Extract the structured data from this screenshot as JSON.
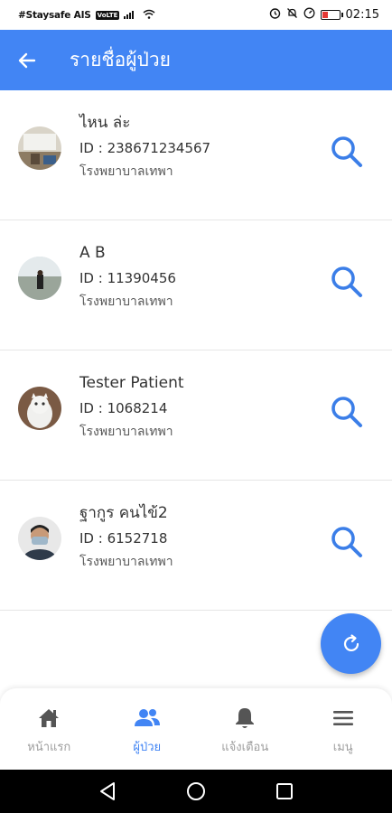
{
  "status_bar": {
    "carrier": "#Staysafe AIS",
    "volte": "VoLTE",
    "time": "02:15"
  },
  "app_bar": {
    "title": "รายชื่อผู้ป่วย"
  },
  "patients": [
    {
      "name": "ไหน ล่ะ",
      "id": "ID : 238671234567",
      "hospital": "โรงพยาบาลเทพา"
    },
    {
      "name": "A B",
      "id": "ID : 11390456",
      "hospital": "โรงพยาบาลเทพา"
    },
    {
      "name": "Tester Patient",
      "id": "ID : 1068214",
      "hospital": "โรงพยาบาลเทพา"
    },
    {
      "name": "ฐากูร คนไข้2",
      "id": "ID : 6152718",
      "hospital": "โรงพยาบาลเทพา"
    }
  ],
  "bottom_nav": {
    "items": [
      {
        "label": "หน้าแรก",
        "icon": "home-icon"
      },
      {
        "label": "ผู้ป่วย",
        "icon": "users-icon"
      },
      {
        "label": "แจ้งเตือน",
        "icon": "bell-icon"
      },
      {
        "label": "เมนู",
        "icon": "menu-icon"
      }
    ],
    "active_index": 1
  },
  "colors": {
    "primary": "#4285f4",
    "inactive": "#9e9e9e"
  }
}
